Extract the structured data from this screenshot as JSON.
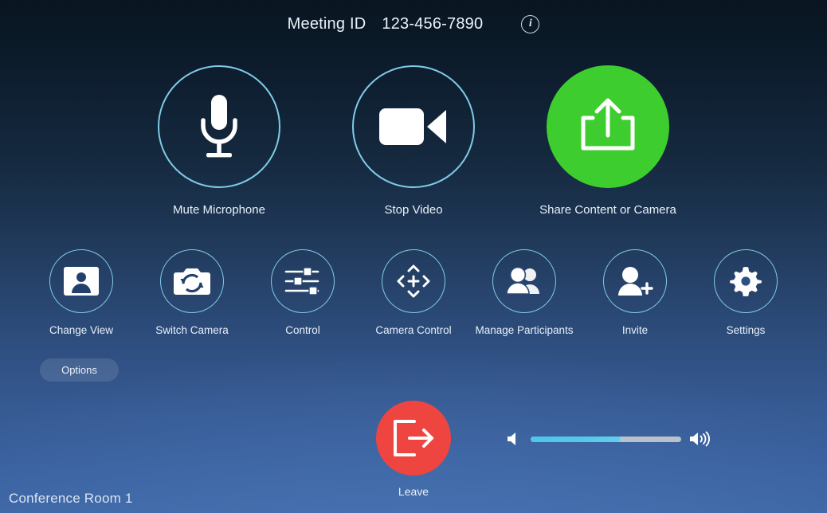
{
  "header": {
    "meeting_id_label": "Meeting ID",
    "meeting_id_value": "123-456-7890",
    "info_icon": "info-icon",
    "info_glyph": "i"
  },
  "primary_controls": [
    {
      "label": "Mute Microphone",
      "icon": "microphone-icon",
      "style": "outline"
    },
    {
      "label": "Stop Video",
      "icon": "video-camera-icon",
      "style": "outline"
    },
    {
      "label": "Share Content or Camera",
      "icon": "share-upload-icon",
      "style": "filled-green"
    }
  ],
  "secondary_controls": [
    {
      "label": "Change View",
      "icon": "person-card-icon"
    },
    {
      "label": "Switch Camera",
      "icon": "camera-switch-icon"
    },
    {
      "label": "Control",
      "icon": "sliders-icon"
    },
    {
      "label": "Camera Control",
      "icon": "dpad-icon"
    },
    {
      "label": "Manage Participants",
      "icon": "people-icon"
    },
    {
      "label": "Invite",
      "icon": "person-add-icon"
    },
    {
      "label": "Settings",
      "icon": "gear-icon"
    }
  ],
  "options": {
    "label": "Options"
  },
  "leave": {
    "label": "Leave",
    "icon": "exit-arrow-icon"
  },
  "volume": {
    "min_icon": "volume-low-icon",
    "max_icon": "volume-high-icon",
    "level_percent": 60
  },
  "footer": {
    "room_name": "Conference Room 1"
  },
  "colors": {
    "share_green": "#3ecd2e",
    "leave_red": "#ee4540",
    "ring_cyan": "#7fcbe6",
    "volume_fill": "#55c9e8",
    "volume_track": "#b9c2cc",
    "bg_top": "#091521",
    "bg_bottom": "#3d65a4",
    "text": "#eaf2fa"
  }
}
